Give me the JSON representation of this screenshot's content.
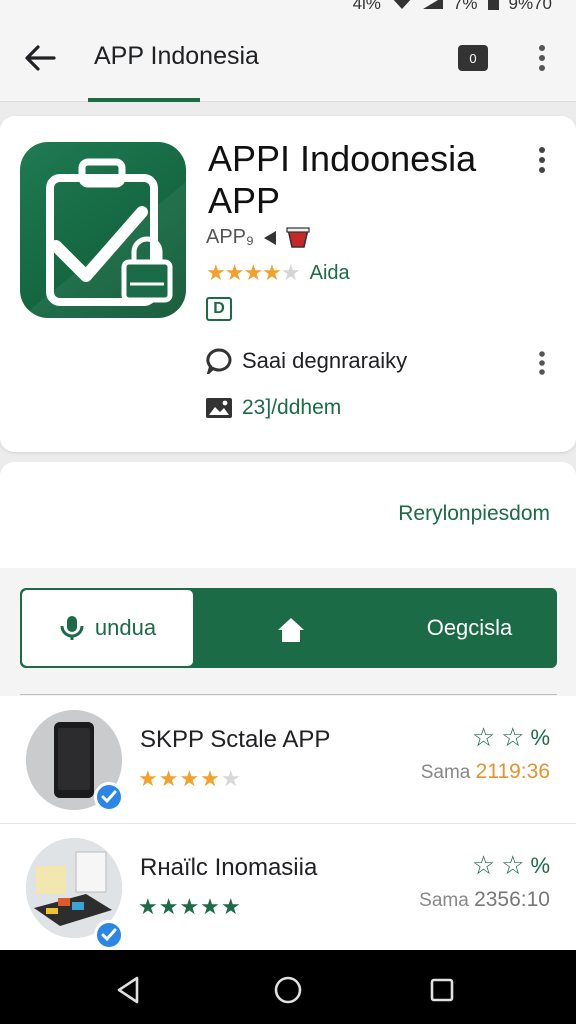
{
  "status_bar": {
    "left_text": "4l%",
    "battery_text": "7%",
    "time": "9%70"
  },
  "app_bar": {
    "title": "APP Indonesia",
    "badge": "0",
    "back_icon": "arrow-left-icon",
    "more_icon": "more-vert-icon"
  },
  "app": {
    "name": "APPI Indoonesia APP",
    "developer": "APP₉",
    "rating_word": "Aida",
    "rating_stars": 4,
    "rating_max": 5,
    "content_rating": "D",
    "info_row_1": "Saai degnraraiky",
    "info_row_2": "23]/ddhem"
  },
  "section": {
    "link": "Rerylonpiesdom"
  },
  "segments": {
    "first": "undua",
    "second_icon": "home-icon",
    "third": "Oegcisla"
  },
  "list": [
    {
      "title": "SKPP Sctale APP",
      "stars": 4,
      "max": 5,
      "star_color": "orange",
      "right_suffix": "%",
      "meta_label": "Sama",
      "meta_value": "2119:36"
    },
    {
      "title": "Rнаïlc Inomasiia",
      "stars": 5,
      "max": 5,
      "star_color": "green",
      "right_suffix": "%",
      "meta_label": "Sama",
      "meta_value": "2356:10"
    }
  ],
  "colors": {
    "accent": "#1b6b47",
    "star": "#f2a22c",
    "verified": "#2b86e6"
  }
}
